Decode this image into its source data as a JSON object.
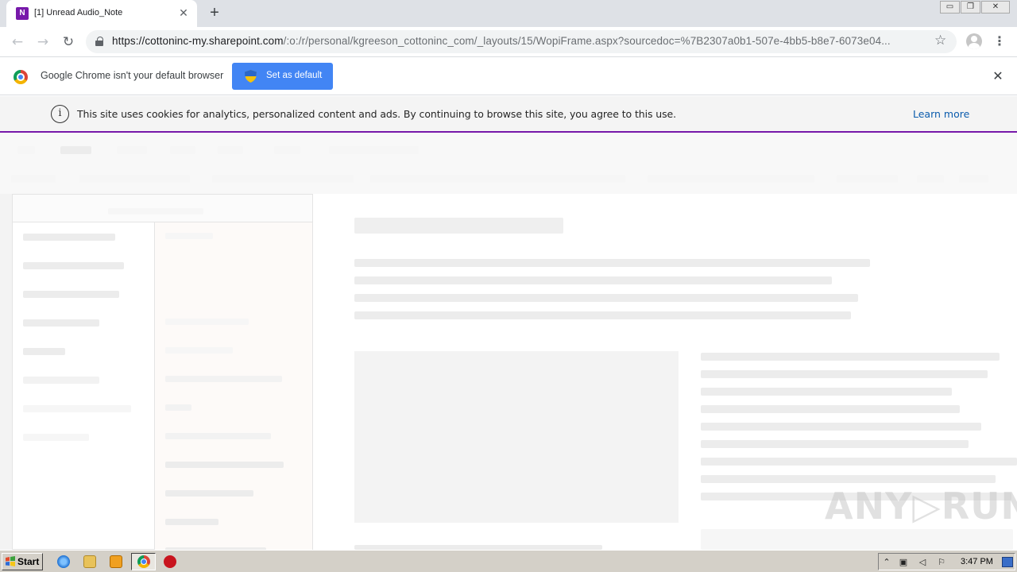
{
  "browser": {
    "tab": {
      "favicon_letter": "N",
      "title": "[1] Unread Audio_Note",
      "close_glyph": "✕"
    },
    "new_tab_glyph": "+",
    "window_controls": [
      "▭",
      "❐",
      "✕"
    ],
    "address": {
      "host": "https://cottoninc-my.sharepoint.com",
      "path": "/:o:/r/personal/kgreeson_cottoninc_com/_layouts/15/WopiFrame.aspx?sourcedoc=%7B2307a0b1-507e-4bb5-b8e7-6073e04..."
    },
    "icons": {
      "back": "back-arrow-icon",
      "forward": "forward-arrow-icon",
      "reload": "reload-icon",
      "bookmark": "star-icon",
      "profile": "profile-icon",
      "menu": "kebab-menu-icon"
    }
  },
  "infobar": {
    "message": "Google Chrome isn't your default browser",
    "button_label": "Set as default",
    "close_glyph": "✕",
    "accent": "#4285f4"
  },
  "cookie_banner": {
    "message": "This site uses cookies for analytics, personalized content and ads. By continuing to browse this site, you agree to this use.",
    "link_label": "Learn more",
    "accent": "#7719aa",
    "link_color": "#0b5cad"
  },
  "watermark": "ANY▷RUN",
  "taskbar": {
    "start_label": "Start",
    "clock": "3:47 PM"
  }
}
